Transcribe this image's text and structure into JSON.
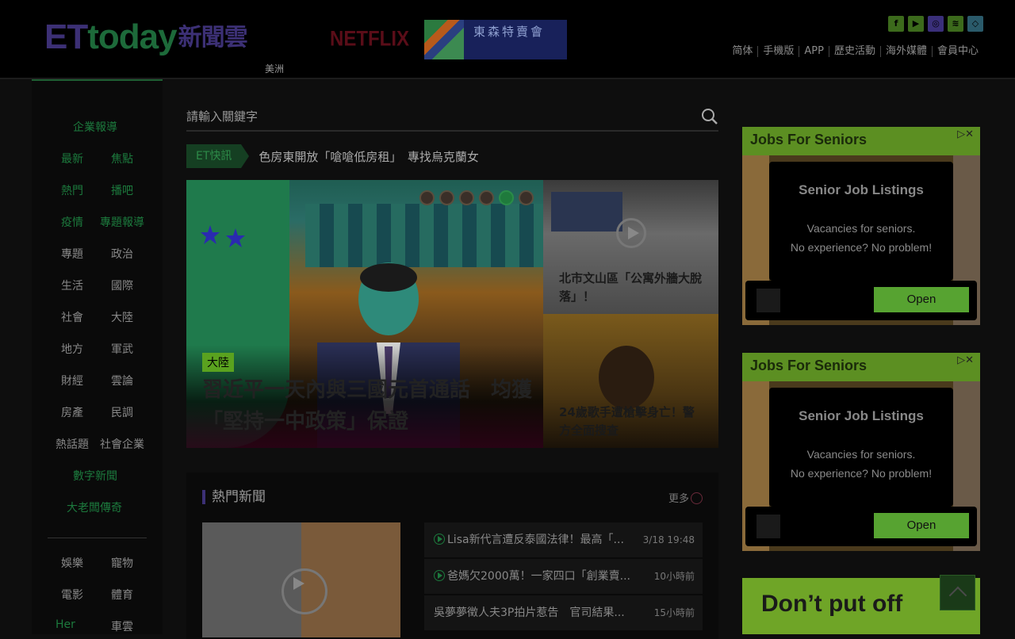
{
  "header": {
    "logo_et": "ET",
    "logo_to": "today",
    "logo_news": "新聞雲",
    "region": "美洲",
    "netflix": "NETFLIX",
    "banner_text": "東森特賣會",
    "social": [
      {
        "icon": "facebook-icon",
        "glyph": "f",
        "color": "#3c6a1c"
      },
      {
        "icon": "youtube-icon",
        "glyph": "▶",
        "color": "#3c6a1c"
      },
      {
        "icon": "instagram-icon",
        "glyph": "◎",
        "color": "#3a2f7a"
      },
      {
        "icon": "rss-icon",
        "glyph": "≋",
        "color": "#3c6a1c"
      },
      {
        "icon": "line-icon",
        "glyph": "◇",
        "color": "#2a5a6a"
      }
    ],
    "nav": [
      "简体",
      "手機版",
      "APP",
      "歷史活動",
      "海外媒體",
      "會員中心"
    ]
  },
  "sidebar": {
    "enterprise": "企業報導",
    "rows": [
      [
        "最新",
        "焦點"
      ],
      [
        "熱門",
        "播吧"
      ],
      [
        "疫情",
        "專題報導"
      ],
      [
        "專題",
        "政治"
      ],
      [
        "生活",
        "國際"
      ],
      [
        "社會",
        "大陸"
      ],
      [
        "地方",
        "軍武"
      ],
      [
        "財經",
        "雲論"
      ],
      [
        "房產",
        "民調"
      ],
      [
        "熱話題",
        "社會企業"
      ]
    ],
    "digital": "數字新聞",
    "boss": "大老闆傳奇",
    "rows2": [
      [
        "娛樂",
        "寵物"
      ],
      [
        "電影",
        "體育"
      ],
      [
        "Her",
        "車雲"
      ]
    ]
  },
  "search": {
    "placeholder": "請輸入關鍵字"
  },
  "flash": {
    "tag": "ET快訊",
    "headline": "色房東開放「嗆嗆低房租」　專找烏克蘭女"
  },
  "hero": {
    "category": "大陸",
    "title": "習近平一天內與三國元首通話　均獲「堅持一中政策」保證"
  },
  "side_cards": [
    {
      "caption": "北市文山區「公寓外牆大脫落」！"
    },
    {
      "caption": "24歲歌手遭槍擊身亡！警方全面搜查"
    }
  ],
  "hot": {
    "heading": "熱門新聞",
    "more": "更多",
    "items": [
      {
        "title": "Lisa新代言遭反泰國法律！最高「...",
        "time": "3/18 19:48",
        "video": true
      },
      {
        "title": "爸媽欠2000萬！一家四口「創業賣...",
        "time": "10小時前",
        "video": true
      },
      {
        "title": "吳夢夢徵人夫3P拍片惹告　官司結果...",
        "time": "15小時前",
        "video": false
      }
    ]
  },
  "ads": [
    {
      "bar": "Jobs For Seniors",
      "title": "Senior Job Listings",
      "line1": "Vacancies for seniors.",
      "line2": "No experience? No problem!",
      "button": "Open"
    },
    {
      "bar": "Jobs For Seniors",
      "title": "Senior Job Listings",
      "line1": "Vacancies for seniors.",
      "line2": "No experience? No problem!",
      "button": "Open"
    }
  ],
  "ad3": {
    "text": "Don’t put off"
  }
}
